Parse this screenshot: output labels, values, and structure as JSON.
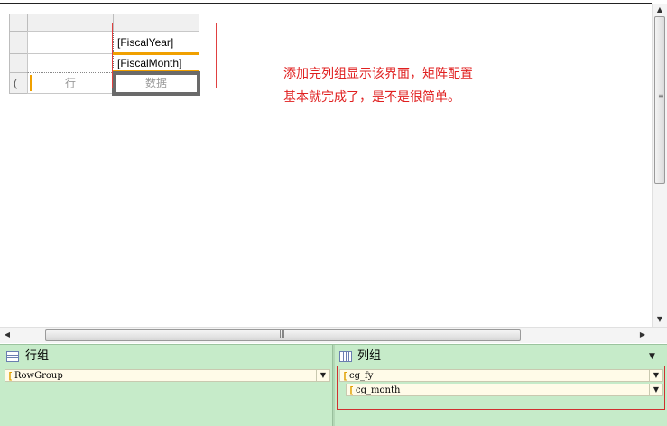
{
  "design": {
    "tablix": {
      "column_field_1": "[FiscalYear]",
      "column_field_2": "[FiscalMonth]",
      "row_placeholder": "行",
      "data_placeholder": "数据",
      "corner_bracket": "("
    },
    "annotation": "添加完列组显示该界面，矩阵配置基本就完成了，是不是很简单。"
  },
  "grouping_pane": {
    "row_groups_title": "行组",
    "column_groups_title": "列组",
    "row_groups": [
      {
        "name": "RowGroup"
      }
    ],
    "column_groups": [
      {
        "name": "cg_fy"
      },
      {
        "name": "cg_month"
      }
    ]
  },
  "colors": {
    "annotation": "#e02020",
    "pane_background": "#c6ebc9",
    "group_bracket": "#e0a000",
    "highlight_border": "#d03030"
  }
}
